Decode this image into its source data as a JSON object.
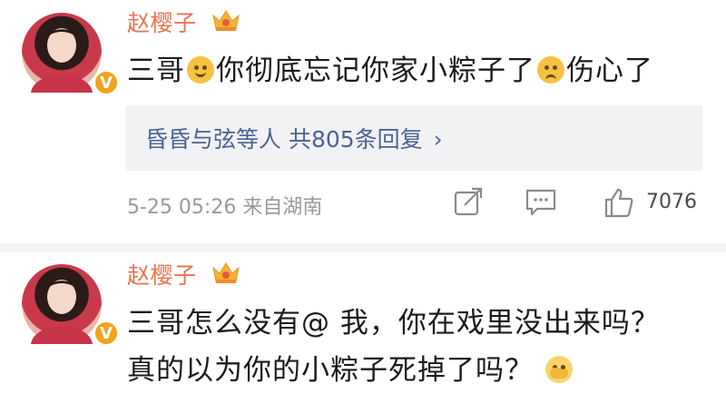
{
  "comments": [
    {
      "username": "赵樱子",
      "text_parts": [
        "三哥",
        "你彻底忘记你家小粽子了",
        "伤心了"
      ],
      "emojis": [
        "smile-emoji",
        "sad-emoji"
      ],
      "replies_summary": "昏昏与弦等人 共805条回复",
      "reply_chevron": "›",
      "meta": "5-25 05:26  来自湖南",
      "like_count": "7076",
      "verified_badge": "V"
    },
    {
      "username": "赵樱子",
      "lines": [
        "三哥怎么没有@ 我，你在戏里没出来吗？",
        "真的以为你的小粽子死掉了吗？"
      ],
      "emojis": [
        "cover-face-emoji"
      ],
      "verified_badge": "V"
    }
  ],
  "colors": {
    "username": "#eb7350",
    "link": "#4a6491",
    "verified": "#f3a21d",
    "meta": "#9a9a9a"
  }
}
